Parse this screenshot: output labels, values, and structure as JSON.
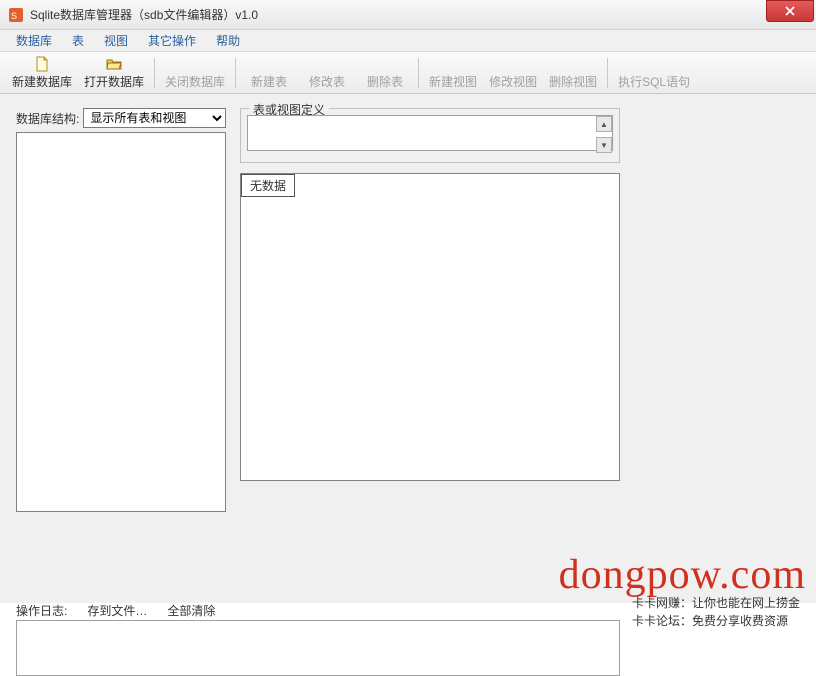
{
  "window": {
    "title": "Sqlite数据库管理器（sdb文件编辑器）v1.0"
  },
  "menu": {
    "items": [
      "数据库",
      "表",
      "视图",
      "其它操作",
      "帮助"
    ]
  },
  "toolbar": {
    "new_db": "新建数据库",
    "open_db": "打开数据库",
    "close_db": "关闭数据库",
    "new_table": "新建表",
    "edit_table": "修改表",
    "delete_table": "删除表",
    "new_view": "新建视图",
    "edit_view": "修改视图",
    "delete_view": "删除视图",
    "exec_sql": "执行SQL语句"
  },
  "left": {
    "struct_label": "数据库结构:",
    "struct_option": "显示所有表和视图"
  },
  "right": {
    "def_legend": "表或视图定义",
    "def_value": "",
    "nodata": "无数据"
  },
  "sidebar": {
    "line1": "卡卡网赚：让你也能在网上捞金",
    "line2": "卡卡论坛：免费分享收费资源"
  },
  "log": {
    "label": "操作日志:",
    "save_file": "存到文件…",
    "clear_all": "全部清除"
  },
  "watermark": "dongpow.com"
}
